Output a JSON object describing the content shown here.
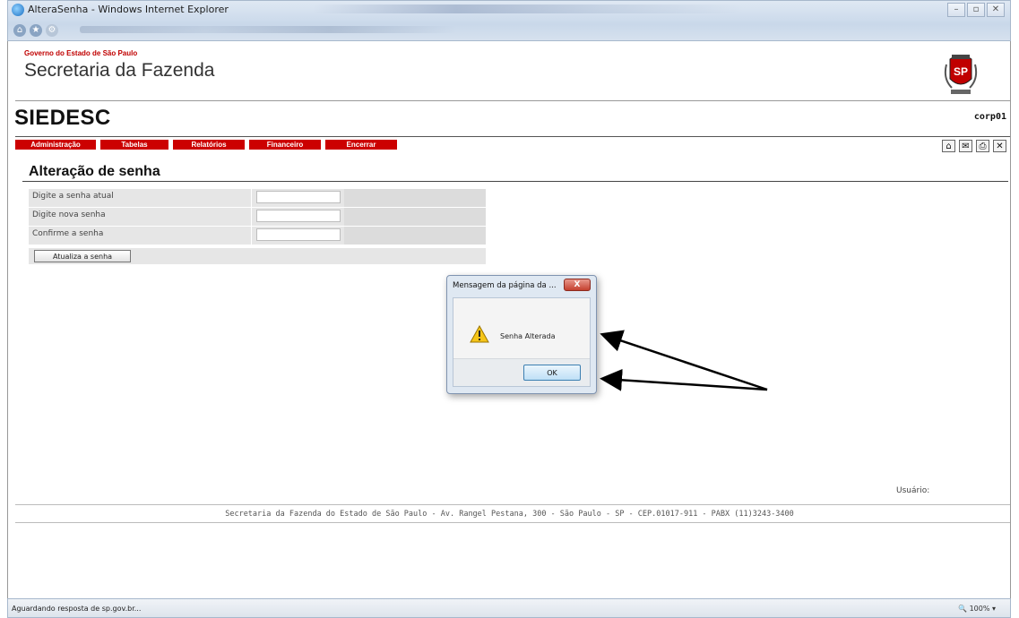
{
  "window": {
    "title": "AlteraSenha - Windows Internet Explorer",
    "controls": [
      "–",
      "▫",
      "✕"
    ]
  },
  "header": {
    "gov_label": "Governo do Estado de São Paulo",
    "secretaria": "Secretaria da Fazenda",
    "crest_text": "SP"
  },
  "app": {
    "title": "SIEDESC",
    "user_code": "corp01"
  },
  "menu": {
    "items": [
      "Administração",
      "Tabelas",
      "Relatórios",
      "Financeiro",
      "Encerrar"
    ],
    "color": "#cc0000"
  },
  "toolbar": {
    "icons": [
      "home-icon",
      "mail-icon",
      "print-icon",
      "close-icon"
    ]
  },
  "page": {
    "title": "Alteração de senha"
  },
  "form": {
    "current_label": "Digite a senha atual",
    "new_label": "Digite nova senha",
    "confirm_label": "Confirme a senha",
    "current_value": "",
    "new_value": "",
    "confirm_value": "",
    "submit_label": "Atualiza a senha"
  },
  "dialog": {
    "title": "Mensagem da página da ...",
    "close_label": "X",
    "message": "Senha Alterada",
    "ok_label": "OK"
  },
  "footer": {
    "user_label": "Usuário:",
    "address": "Secretaria da Fazenda do Estado de São Paulo - Av. Rangel Pestana, 300 - São Paulo - SP - CEP.01017-911 - PABX (11)3243-3400"
  },
  "statusbar": {
    "text": "Aguardando resposta de sp.gov.br...",
    "zoom": "100%"
  }
}
